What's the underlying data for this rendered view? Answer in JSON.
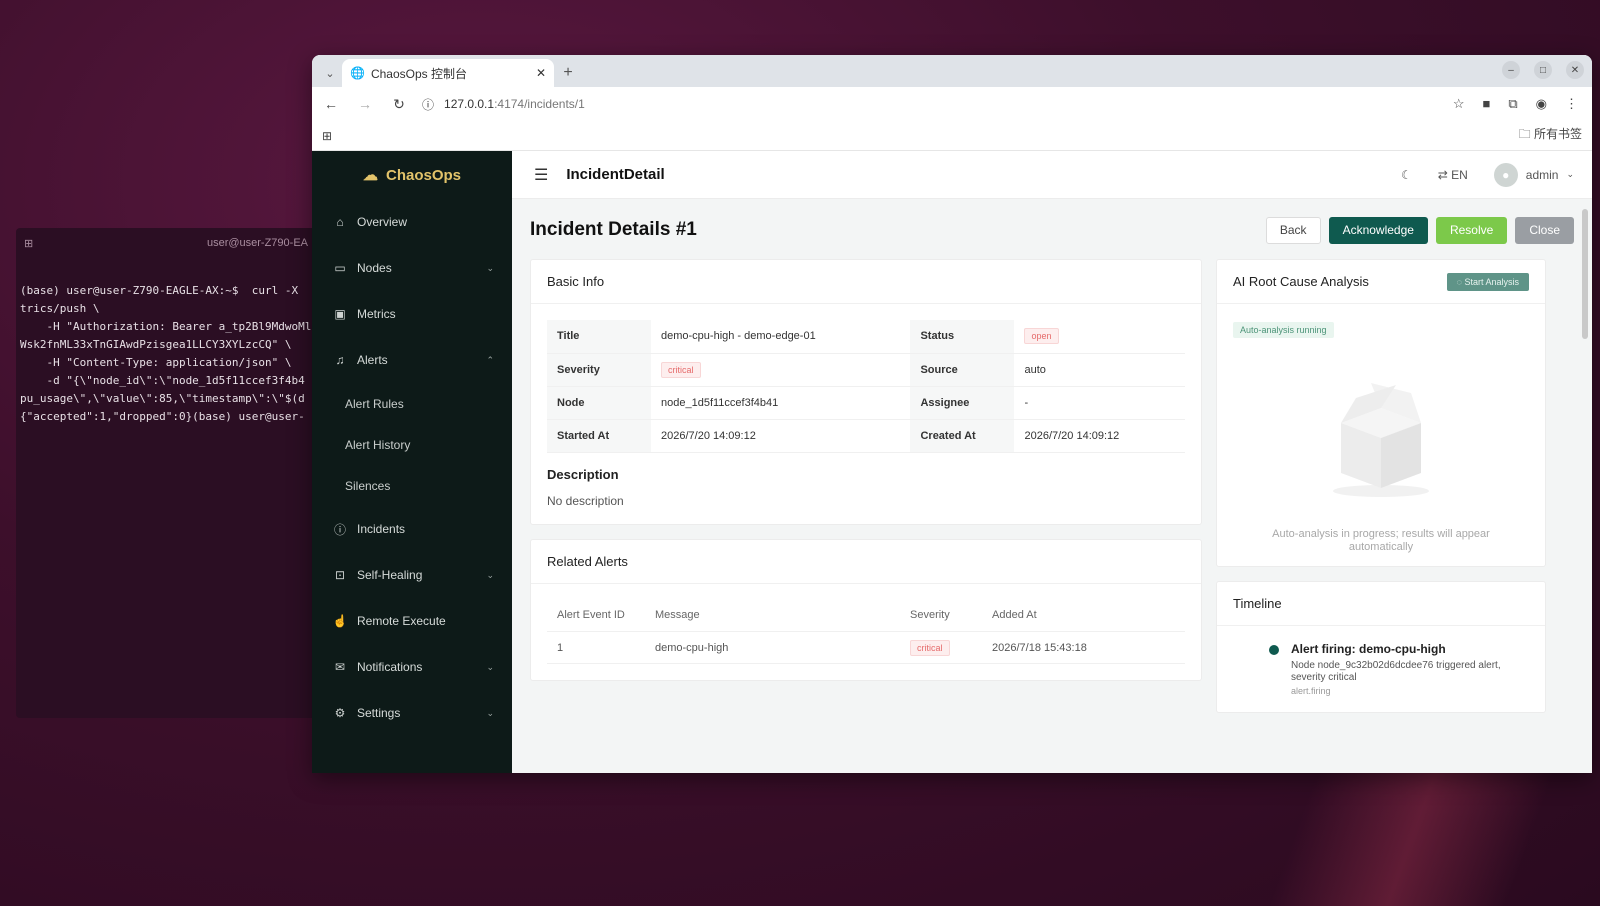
{
  "terminal": {
    "title": "user@user-Z790-EA",
    "lines": [
      "(base) user@user-Z790-EAGLE-AX:~$  curl -X",
      "trics/push \\",
      "    -H \"Authorization: Bearer a_tp2Bl9MdwoMl",
      "Wsk2fnML33xTnGIAwdPzisgea1LLCY3XYLzcCQ\" \\",
      "    -H \"Content-Type: application/json\" \\",
      "    -d \"{\\\"node_id\\\":\\\"node_1d5f11ccef3f4b4",
      "pu_usage\\\",\\\"value\\\":85,\\\"timestamp\\\":\\\"$(d",
      "{\"accepted\":1,\"dropped\":0}(base) user@user-"
    ]
  },
  "browser": {
    "tab_title": "ChaosOps 控制台",
    "url_host": "127.0.0.1",
    "url_rest": ":4174/incidents/1",
    "bookmarks_label": "所有书签"
  },
  "sidebar": {
    "brand": "ChaosOps",
    "items": [
      {
        "label": "Overview"
      },
      {
        "label": "Nodes"
      },
      {
        "label": "Metrics"
      },
      {
        "label": "Alerts"
      },
      {
        "label": "Alert Rules"
      },
      {
        "label": "Alert History"
      },
      {
        "label": "Silences"
      },
      {
        "label": "Incidents"
      },
      {
        "label": "Self-Healing"
      },
      {
        "label": "Remote Execute"
      },
      {
        "label": "Notifications"
      },
      {
        "label": "Settings"
      }
    ]
  },
  "topbar": {
    "page_name": "IncidentDetail",
    "lang": "EN",
    "user": "admin"
  },
  "header": {
    "title": "Incident Details #1",
    "back": "Back",
    "acknowledge": "Acknowledge",
    "resolve": "Resolve",
    "close": "Close"
  },
  "basic_info": {
    "heading": "Basic Info",
    "title_label": "Title",
    "title_value": "demo-cpu-high - demo-edge-01",
    "status_label": "Status",
    "status_value": "open",
    "severity_label": "Severity",
    "severity_value": "critical",
    "source_label": "Source",
    "source_value": "auto",
    "node_label": "Node",
    "node_value": "node_1d5f11ccef3f4b41",
    "assignee_label": "Assignee",
    "assignee_value": "-",
    "started_label": "Started At",
    "started_value": "2026/7/20 14:09:12",
    "created_label": "Created At",
    "created_value": "2026/7/20 14:09:12",
    "description_heading": "Description",
    "description_text": "No description"
  },
  "related_alerts": {
    "heading": "Related Alerts",
    "columns": [
      "Alert Event ID",
      "Message",
      "Severity",
      "Added At"
    ],
    "rows": [
      {
        "id": "1",
        "message": "demo-cpu-high",
        "severity": "critical",
        "added": "2026/7/18 15:43:18"
      }
    ]
  },
  "ai_analysis": {
    "heading": "AI Root Cause Analysis",
    "start_button": "Start Analysis",
    "running_tag": "Auto-analysis running",
    "empty_text": "Auto-analysis in progress; results will appear automatically"
  },
  "timeline": {
    "heading": "Timeline",
    "items": [
      {
        "title": "Alert firing: demo-cpu-high",
        "text": "Node node_9c32b02d6dcdee76 triggered alert, severity critical",
        "meta": "alert.firing"
      }
    ]
  },
  "colors": {
    "primary": "#0f5a4f",
    "success": "#7cc94a",
    "sidebar_bg": "#0d1a18",
    "brand": "#e2c36a",
    "danger": "#e56b6b"
  }
}
